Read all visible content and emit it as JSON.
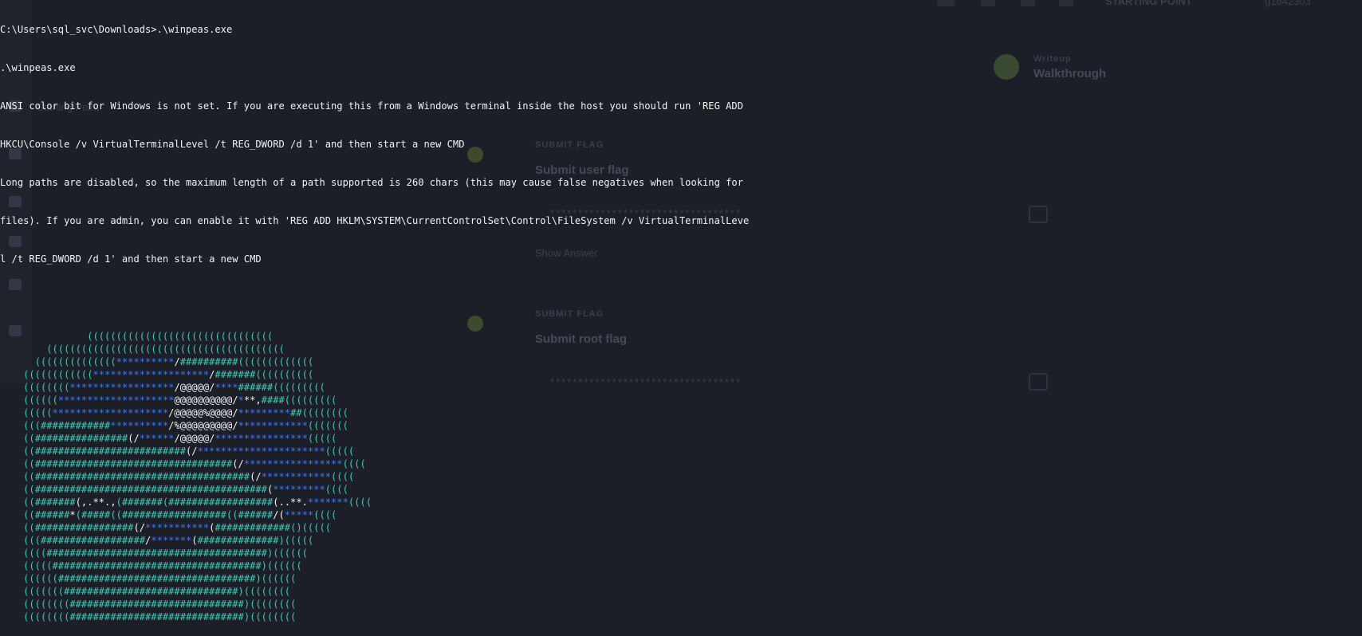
{
  "background_app": {
    "nav_items": [
      "Starting Point"
    ],
    "topbar": {
      "button": "STARTING POINT",
      "username": "g1642303"
    },
    "task_tags": [
      "Walkthrough"
    ],
    "walkthrough_label": "Writeup",
    "tasks": [
      {
        "section": "SUBMIT FLAG",
        "title": "Submit user flag",
        "placeholder": "**********************************",
        "action": "Show Answer"
      },
      {
        "section": "SUBMIT FLAG",
        "title": "Submit root flag",
        "placeholder": "**********************************"
      }
    ]
  },
  "terminal": {
    "lines": [
      "C:\\Users\\sql_svc\\Downloads>.\\winpeas.exe",
      ".\\winpeas.exe",
      "ANSI color bit for Windows is not set. If you are executing this from a Windows terminal inside the host you should run 'REG ADD",
      "HKCU\\Console /v VirtualTerminalLevel /t REG_DWORD /d 1' and then start a new CMD",
      "Long paths are disabled, so the maximum length of a path supported is 260 chars (this may cause false negatives when looking for",
      "files). If you are admin, you can enable it with 'REG ADD HKLM\\SYSTEM\\CurrentControlSet\\Control\\FileSystem /v VirtualTerminalLeve",
      "l /t REG_DWORD /d 1' and then start a new CMD"
    ],
    "art": [
      [
        [
          "               ",
          "c"
        ],
        [
          "((((((((((((((((((((((((((((((((",
          "c"
        ]
      ],
      [
        [
          "        ",
          "c"
        ],
        [
          "(((((((((((((((((((((((((((((((((((((((((",
          "c"
        ]
      ],
      [
        [
          "      ",
          "c"
        ],
        [
          "((((((((((((((",
          "c"
        ],
        [
          "**********",
          "b"
        ],
        [
          "/",
          "w"
        ],
        [
          "##########",
          "c"
        ],
        [
          "(((((((((((((",
          "c"
        ]
      ],
      [
        [
          "    ",
          "c"
        ],
        [
          "((((((((((((",
          "c"
        ],
        [
          "********************",
          "b"
        ],
        [
          "/",
          "w"
        ],
        [
          "#######",
          "c"
        ],
        [
          "((((((((((",
          "c"
        ]
      ],
      [
        [
          "    ",
          "c"
        ],
        [
          "((((((((",
          "c"
        ],
        [
          "******************",
          "b"
        ],
        [
          "/@@@@@/",
          "w"
        ],
        [
          "****",
          "b"
        ],
        [
          "######",
          "c"
        ],
        [
          "(((((((((",
          "c"
        ]
      ],
      [
        [
          "    ",
          "c"
        ],
        [
          "((((((",
          "c"
        ],
        [
          "********************",
          "b"
        ],
        [
          "@@@@@@@@@@/",
          "w"
        ],
        [
          "*",
          "b"
        ],
        [
          "**",
          "w"
        ],
        [
          ",",
          "w"
        ],
        [
          "####",
          "c"
        ],
        [
          "(((((((((",
          "c"
        ]
      ],
      [
        [
          "    ",
          "c"
        ],
        [
          "(((((",
          "c"
        ],
        [
          "********************",
          "b"
        ],
        [
          "/@@@@@%@@@@/",
          "w"
        ],
        [
          "*********",
          "b"
        ],
        [
          "##",
          "c"
        ],
        [
          "((((((((",
          "c"
        ]
      ],
      [
        [
          "    ",
          "c"
        ],
        [
          "(((",
          "c"
        ],
        [
          "############",
          "c"
        ],
        [
          "**********",
          "b"
        ],
        [
          "/%@@@@@@@@@/",
          "w"
        ],
        [
          "************",
          "b"
        ],
        [
          "(((((((",
          "c"
        ]
      ],
      [
        [
          "    ",
          "c"
        ],
        [
          "((",
          "c"
        ],
        [
          "################",
          "c"
        ],
        [
          "(/",
          "w"
        ],
        [
          "******",
          "b"
        ],
        [
          "/@@@@@/",
          "w"
        ],
        [
          "****************",
          "b"
        ],
        [
          "(((((",
          "c"
        ]
      ],
      [
        [
          "    ",
          "c"
        ],
        [
          "((",
          "c"
        ],
        [
          "##########################",
          "c"
        ],
        [
          "(/",
          "w"
        ],
        [
          "**********************",
          "b"
        ],
        [
          "(((((",
          "c"
        ]
      ],
      [
        [
          "    ",
          "c"
        ],
        [
          "((",
          "c"
        ],
        [
          "##################################",
          "c"
        ],
        [
          "(/",
          "w"
        ],
        [
          "*****************",
          "b"
        ],
        [
          "((((",
          "c"
        ]
      ],
      [
        [
          "    ",
          "c"
        ],
        [
          "((",
          "c"
        ],
        [
          "#####################################",
          "c"
        ],
        [
          "(/",
          "w"
        ],
        [
          "************",
          "b"
        ],
        [
          "((((",
          "c"
        ]
      ],
      [
        [
          "    ",
          "c"
        ],
        [
          "((",
          "c"
        ],
        [
          "########################################",
          "c"
        ],
        [
          "(",
          "w"
        ],
        [
          "*********",
          "b"
        ],
        [
          "((((",
          "c"
        ]
      ],
      [
        [
          "    ",
          "c"
        ],
        [
          "((",
          "c"
        ],
        [
          "#######",
          "c"
        ],
        [
          "(,.**.,",
          "w"
        ],
        [
          "(",
          "c"
        ],
        [
          "#######",
          "c"
        ],
        [
          "(",
          "c"
        ],
        [
          "##################",
          "c"
        ],
        [
          "(..**.",
          "w"
        ],
        [
          "*******",
          "b"
        ],
        [
          "((((",
          "c"
        ]
      ],
      [
        [
          "    ",
          "c"
        ],
        [
          "((",
          "c"
        ],
        [
          "######",
          "c"
        ],
        [
          "*",
          "w"
        ],
        [
          "(",
          "c"
        ],
        [
          "#####",
          "c"
        ],
        [
          "((",
          "c"
        ],
        [
          "##################",
          "c"
        ],
        [
          "((",
          "c"
        ],
        [
          "######",
          "c"
        ],
        [
          "/(",
          "w"
        ],
        [
          "*****",
          "b"
        ],
        [
          "((((",
          "c"
        ]
      ],
      [
        [
          "    ",
          "c"
        ],
        [
          "((",
          "c"
        ],
        [
          "#################",
          "c"
        ],
        [
          "(/",
          "w"
        ],
        [
          "***********",
          "b"
        ],
        [
          "(",
          "w"
        ],
        [
          "#############",
          "c"
        ],
        [
          "()(((((",
          "c"
        ]
      ],
      [
        [
          "    ",
          "c"
        ],
        [
          "(((",
          "c"
        ],
        [
          "##################",
          "c"
        ],
        [
          "/",
          "w"
        ],
        [
          "*******",
          "b"
        ],
        [
          "(",
          "w"
        ],
        [
          "##############",
          "c"
        ],
        [
          ")(((((",
          "c"
        ]
      ],
      [
        [
          "    ",
          "c"
        ],
        [
          "((((",
          "c"
        ],
        [
          "######################################",
          "c"
        ],
        [
          ")((((((",
          "c"
        ]
      ],
      [
        [
          "    ",
          "c"
        ],
        [
          "(((((",
          "c"
        ],
        [
          "####################################",
          "c"
        ],
        [
          ")((((((",
          "c"
        ]
      ],
      [
        [
          "    ",
          "c"
        ],
        [
          "((((((",
          "c"
        ],
        [
          "##################################",
          "c"
        ],
        [
          ")((((((",
          "c"
        ]
      ],
      [
        [
          "    ",
          "c"
        ],
        [
          "(((((((",
          "c"
        ],
        [
          "##############################",
          "c"
        ],
        [
          ")((((((((",
          "c"
        ]
      ],
      [
        [
          "    ",
          "c"
        ],
        [
          "((((((((",
          "c"
        ],
        [
          "##############################",
          "c"
        ],
        [
          ")((((((((",
          "c"
        ]
      ],
      [
        [
          "    ",
          "c"
        ],
        [
          "((((((((",
          "c"
        ],
        [
          "##############################",
          "c"
        ],
        [
          ")((((((((",
          "c"
        ]
      ]
    ]
  }
}
